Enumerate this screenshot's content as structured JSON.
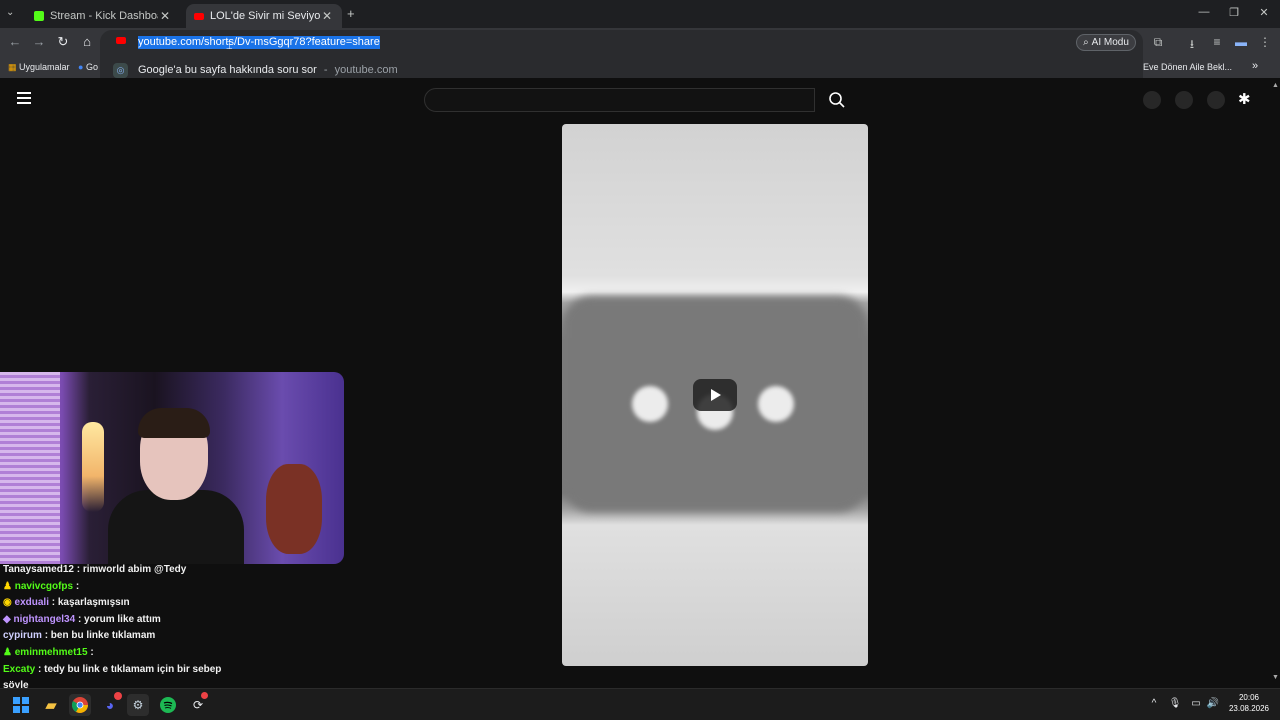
{
  "tabs": [
    {
      "label": "Stream - Kick Dashboard",
      "favicon": "kick-icon",
      "active": false
    },
    {
      "label": "LOL'de Sivir mi Seviyorsun? ML",
      "favicon": "youtube-icon",
      "active": true
    }
  ],
  "omnibox": {
    "url": "youtube.com/shorts/Dv-msGgqr78?feature=share",
    "suggestion": "Google'a bu sayfa hakkında soru sor",
    "suggestion_domain": "youtube.com",
    "separator": "-",
    "ai_mode_label": "AI Modu"
  },
  "bookmarks": {
    "apps_label": "Uygulamalar",
    "google_label": "Go",
    "right_label": "Eve Dönen Aile Bekl...",
    "more": "»"
  },
  "chat": [
    {
      "user": "Tanaysamed12",
      "text": ": rimworld abim @Tedy",
      "color": "#f1f1f1"
    },
    {
      "user": "navivcgofps",
      "text": ":",
      "color": "#53fc18"
    },
    {
      "user": "exduali",
      "text": ": kaşarlaşmışsın",
      "color": "#bf94ff"
    },
    {
      "user": "nightangel34",
      "text": ": yorum like attım",
      "color": "#bf94ff"
    },
    {
      "user": "cypirum",
      "text": ": ben bu linke tıklamam",
      "color": "#d0d0ff"
    },
    {
      "user": "eminmehmet15",
      "text": ":",
      "color": "#53fc18"
    },
    {
      "user": "Excaty",
      "text": ": tedy bu link e tıklamam için bir sebep",
      "color": "#53fc18"
    },
    {
      "user": "",
      "text": "söyle",
      "color": "#f1f1f1"
    }
  ],
  "clock": {
    "time": "20:06",
    "date": "23.08.2026"
  },
  "taskbar_apps": [
    "windows-start-icon",
    "file-explorer-icon",
    "chrome-icon",
    "discord-icon",
    "steam-icon",
    "spotify-icon",
    "misc-app-icon"
  ],
  "colors": {
    "accent": "#1a73e8",
    "kick_green": "#53fc18",
    "youtube_red": "#ff0000"
  }
}
